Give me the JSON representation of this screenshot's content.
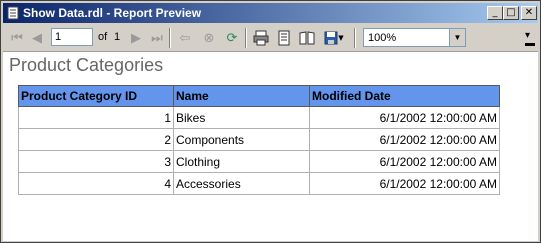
{
  "window": {
    "title": "Show Data.rdl - Report Preview",
    "controls": {
      "minimize": "_",
      "maximize": "□",
      "close": "✕"
    }
  },
  "toolbar": {
    "page_value": "1",
    "of_label": "of",
    "total_pages": "1",
    "zoom_value": "100%"
  },
  "report": {
    "title": "Product Categories",
    "columns": [
      "Product Category ID",
      "Name",
      "Modified Date"
    ],
    "rows": [
      [
        "1",
        "Bikes",
        "6/1/2002 12:00:00 AM"
      ],
      [
        "2",
        "Components",
        "6/1/2002 12:00:00 AM"
      ],
      [
        "3",
        "Clothing",
        "6/1/2002 12:00:00 AM"
      ],
      [
        "4",
        "Accessories",
        "6/1/2002 12:00:00 AM"
      ]
    ]
  },
  "colors": {
    "header_bg": "#6495ed",
    "titlebar_start": "#0a246a",
    "titlebar_end": "#a6caf0"
  }
}
